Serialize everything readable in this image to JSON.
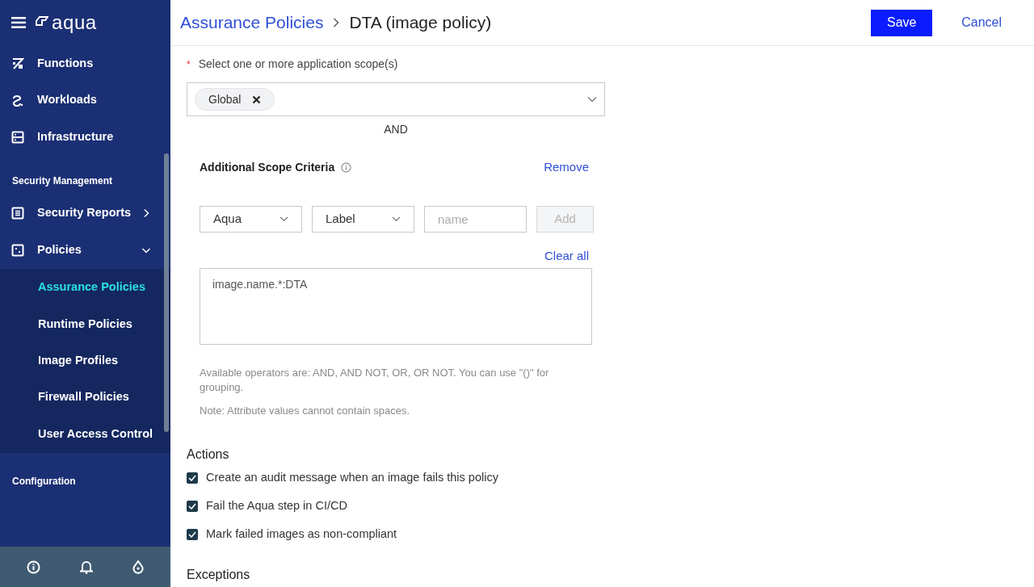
{
  "sidebar": {
    "brand": "aqua",
    "items": [
      {
        "label": "Functions",
        "kind": "functions"
      },
      {
        "label": "Workloads",
        "kind": "workloads"
      },
      {
        "label": "Infrastructure",
        "kind": "infrastructure"
      }
    ],
    "sections": [
      {
        "title": "Security Management",
        "items": [
          {
            "label": "Security Reports",
            "kind": "reports",
            "expanded": false
          },
          {
            "label": "Policies",
            "kind": "policies",
            "expanded": true,
            "children": [
              {
                "label": "Assurance Policies",
                "selected": true
              },
              {
                "label": "Runtime Policies",
                "selected": false
              },
              {
                "label": "Image Profiles",
                "selected": false
              },
              {
                "label": "Firewall Policies",
                "selected": false
              },
              {
                "label": "User Access Control",
                "selected": false
              }
            ]
          }
        ]
      },
      {
        "title": "Configuration"
      }
    ]
  },
  "header": {
    "breadcrumb": "Assurance Policies",
    "title": "DTA (image policy)",
    "save": "Save",
    "cancel": "Cancel"
  },
  "scope": {
    "label": "Select one or more application scope(s)",
    "required_mark": "*",
    "tags": [
      "Global"
    ],
    "joiner": "AND"
  },
  "criteria": {
    "title": "Additional Scope Criteria",
    "remove": "Remove",
    "source": "Aqua",
    "attribute": "Label",
    "name_placeholder": "name",
    "add": "Add",
    "clear": "Clear all",
    "expression": "image.name.*:DTA",
    "help": "Available operators are: AND, AND NOT, OR, OR NOT. You can use \"()\" for grouping.",
    "note": "Note: Attribute values cannot contain spaces."
  },
  "actions": {
    "title": "Actions",
    "items": [
      {
        "label": "Create an audit message when an image fails this policy",
        "checked": true
      },
      {
        "label": "Fail the Aqua step in CI/CD",
        "checked": true
      },
      {
        "label": "Mark failed images as non-compliant",
        "checked": true
      }
    ]
  },
  "exceptions": {
    "title": "Exceptions"
  }
}
